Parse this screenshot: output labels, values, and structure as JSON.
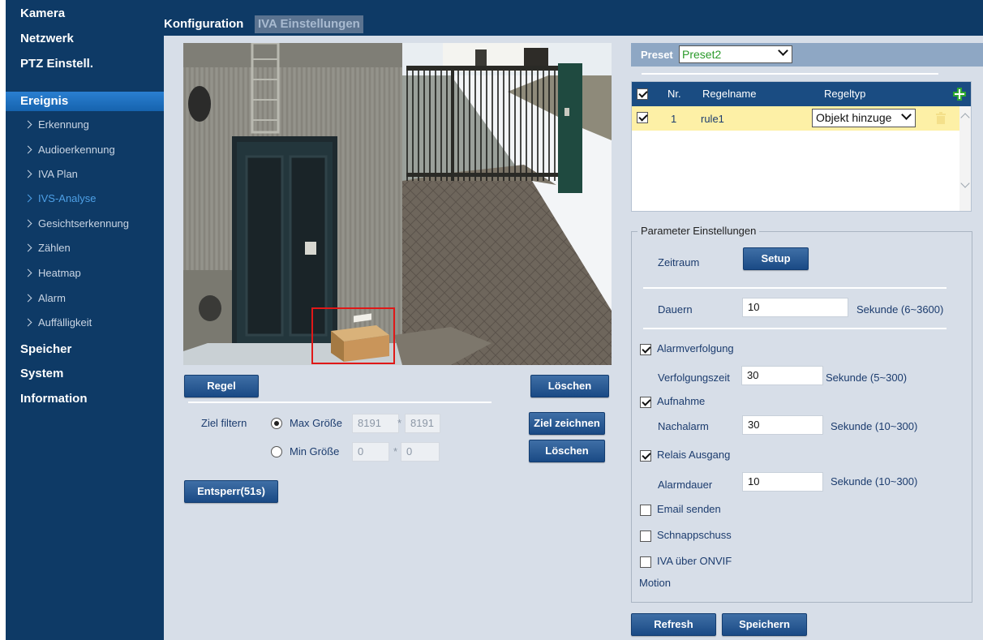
{
  "sidebar": {
    "items": [
      {
        "label": "Kamera",
        "level": "main"
      },
      {
        "label": "Netzwerk",
        "level": "main"
      },
      {
        "label": "PTZ Einstell.",
        "level": "main"
      },
      {
        "label": "Ereignis",
        "level": "main",
        "active": true
      },
      {
        "label": "Erkennung",
        "level": "sub"
      },
      {
        "label": "Audioerkennung",
        "level": "sub"
      },
      {
        "label": "IVA Plan",
        "level": "sub"
      },
      {
        "label": "IVS-Analyse",
        "level": "sub",
        "active": true
      },
      {
        "label": "Gesichtserkennung",
        "level": "sub"
      },
      {
        "label": "Zählen",
        "level": "sub"
      },
      {
        "label": "Heatmap",
        "level": "sub"
      },
      {
        "label": "Alarm",
        "level": "sub"
      },
      {
        "label": "Auffälligkeit",
        "level": "sub"
      },
      {
        "label": "Speicher",
        "level": "main"
      },
      {
        "label": "System",
        "level": "main"
      },
      {
        "label": "Information",
        "level": "main"
      }
    ]
  },
  "tabs": {
    "konfiguration": "Konfiguration",
    "iva": "IVA Einstellungen"
  },
  "left": {
    "regel_button": "Regel",
    "loeschen_button": "Löschen",
    "ziel_filtern_label": "Ziel filtern",
    "max_groesse_label": "Max Größe",
    "max_w": "8191",
    "max_h": "8191",
    "min_groesse_label": "Min Größe",
    "min_w": "0",
    "min_h": "0",
    "times": "*",
    "ziel_zeichnen_button": "Ziel zeichnen",
    "loeschen2_button": "Löschen",
    "entsperr_button": "Entsperr(51s)",
    "filter_mode": "max"
  },
  "preset": {
    "label": "Preset",
    "value": "Preset2"
  },
  "rules": {
    "headers": [
      "Nr.",
      "Regelname",
      "Regeltyp"
    ],
    "rows": [
      {
        "nr": "1",
        "name": "rule1",
        "type": "Objekt hinzuge",
        "checked": true
      }
    ]
  },
  "params": {
    "legend": "Parameter Einstellungen",
    "zeitraum_label": "Zeitraum",
    "setup_button": "Setup",
    "dauern_label": "Dauern",
    "dauern_value": "10",
    "dauern_unit": "Sekunde (6~3600)",
    "alarmverfolgung_label": "Alarmverfolgung",
    "alarmverfolgung": true,
    "verfolgungszeit_label": "Verfolgungszeit",
    "verfolgungszeit_value": "30",
    "verfolgungszeit_unit": "Sekunde (5~300)",
    "aufnahme_label": "Aufnahme",
    "aufnahme": true,
    "nachalarm_label": "Nachalarm",
    "nachalarm_value": "30",
    "nachalarm_unit": "Sekunde (10~300)",
    "relais_label": "Relais Ausgang",
    "relais": true,
    "alarmdauer_label": "Alarmdauer",
    "alarmdauer_value": "10",
    "alarmdauer_unit": "Sekunde (10~300)",
    "email_label": "Email senden",
    "email": false,
    "schnappschuss_label": "Schnappschuss",
    "schnappschuss": false,
    "onvif_label": "IVA über ONVIF",
    "onvif": false,
    "motion_label": "Motion"
  },
  "footer": {
    "refresh_button": "Refresh",
    "speichern_button": "Speichern"
  },
  "colors": {
    "nav_bg": "#0e3a66",
    "content_bg": "#d7dee8",
    "button": "#1a4a85",
    "selected_row": "#fdf0a6",
    "detection_box": "#e01818",
    "add_icon": "#2fa82f"
  }
}
